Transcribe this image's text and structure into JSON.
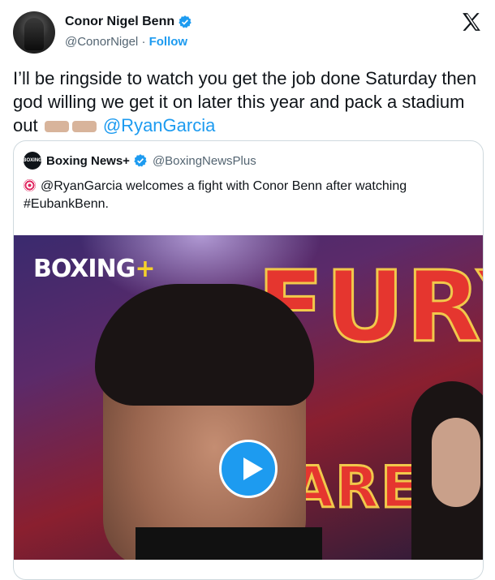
{
  "author": {
    "name": "Conor Nigel Benn",
    "handle": "@ConorNigel",
    "separator": "·",
    "follow_label": "Follow"
  },
  "tweet": {
    "text": "I’ll be ringside to watch you get the job done Saturday then god willing we get it on later this year and pack a stadium out",
    "mention": "@RyanGarcia"
  },
  "quote": {
    "name": "Boxing News+",
    "handle": "@BoxingNewsPlus",
    "logo_text": "BOXING",
    "text": "@RyanGarcia welcomes a fight with Conor Benn after watching #EubankBenn.",
    "media": {
      "watermark_main": "BOXING",
      "watermark_plus": "+",
      "bg_word_top": "FURY",
      "bg_word_bottom": "ARE"
    }
  },
  "colors": {
    "accent": "#1d9bf0",
    "text": "#0f1419",
    "muted": "#536471",
    "border": "#cfd9de"
  },
  "icons": [
    "verified-badge-icon",
    "x-logo-icon",
    "target-icon",
    "play-icon"
  ]
}
